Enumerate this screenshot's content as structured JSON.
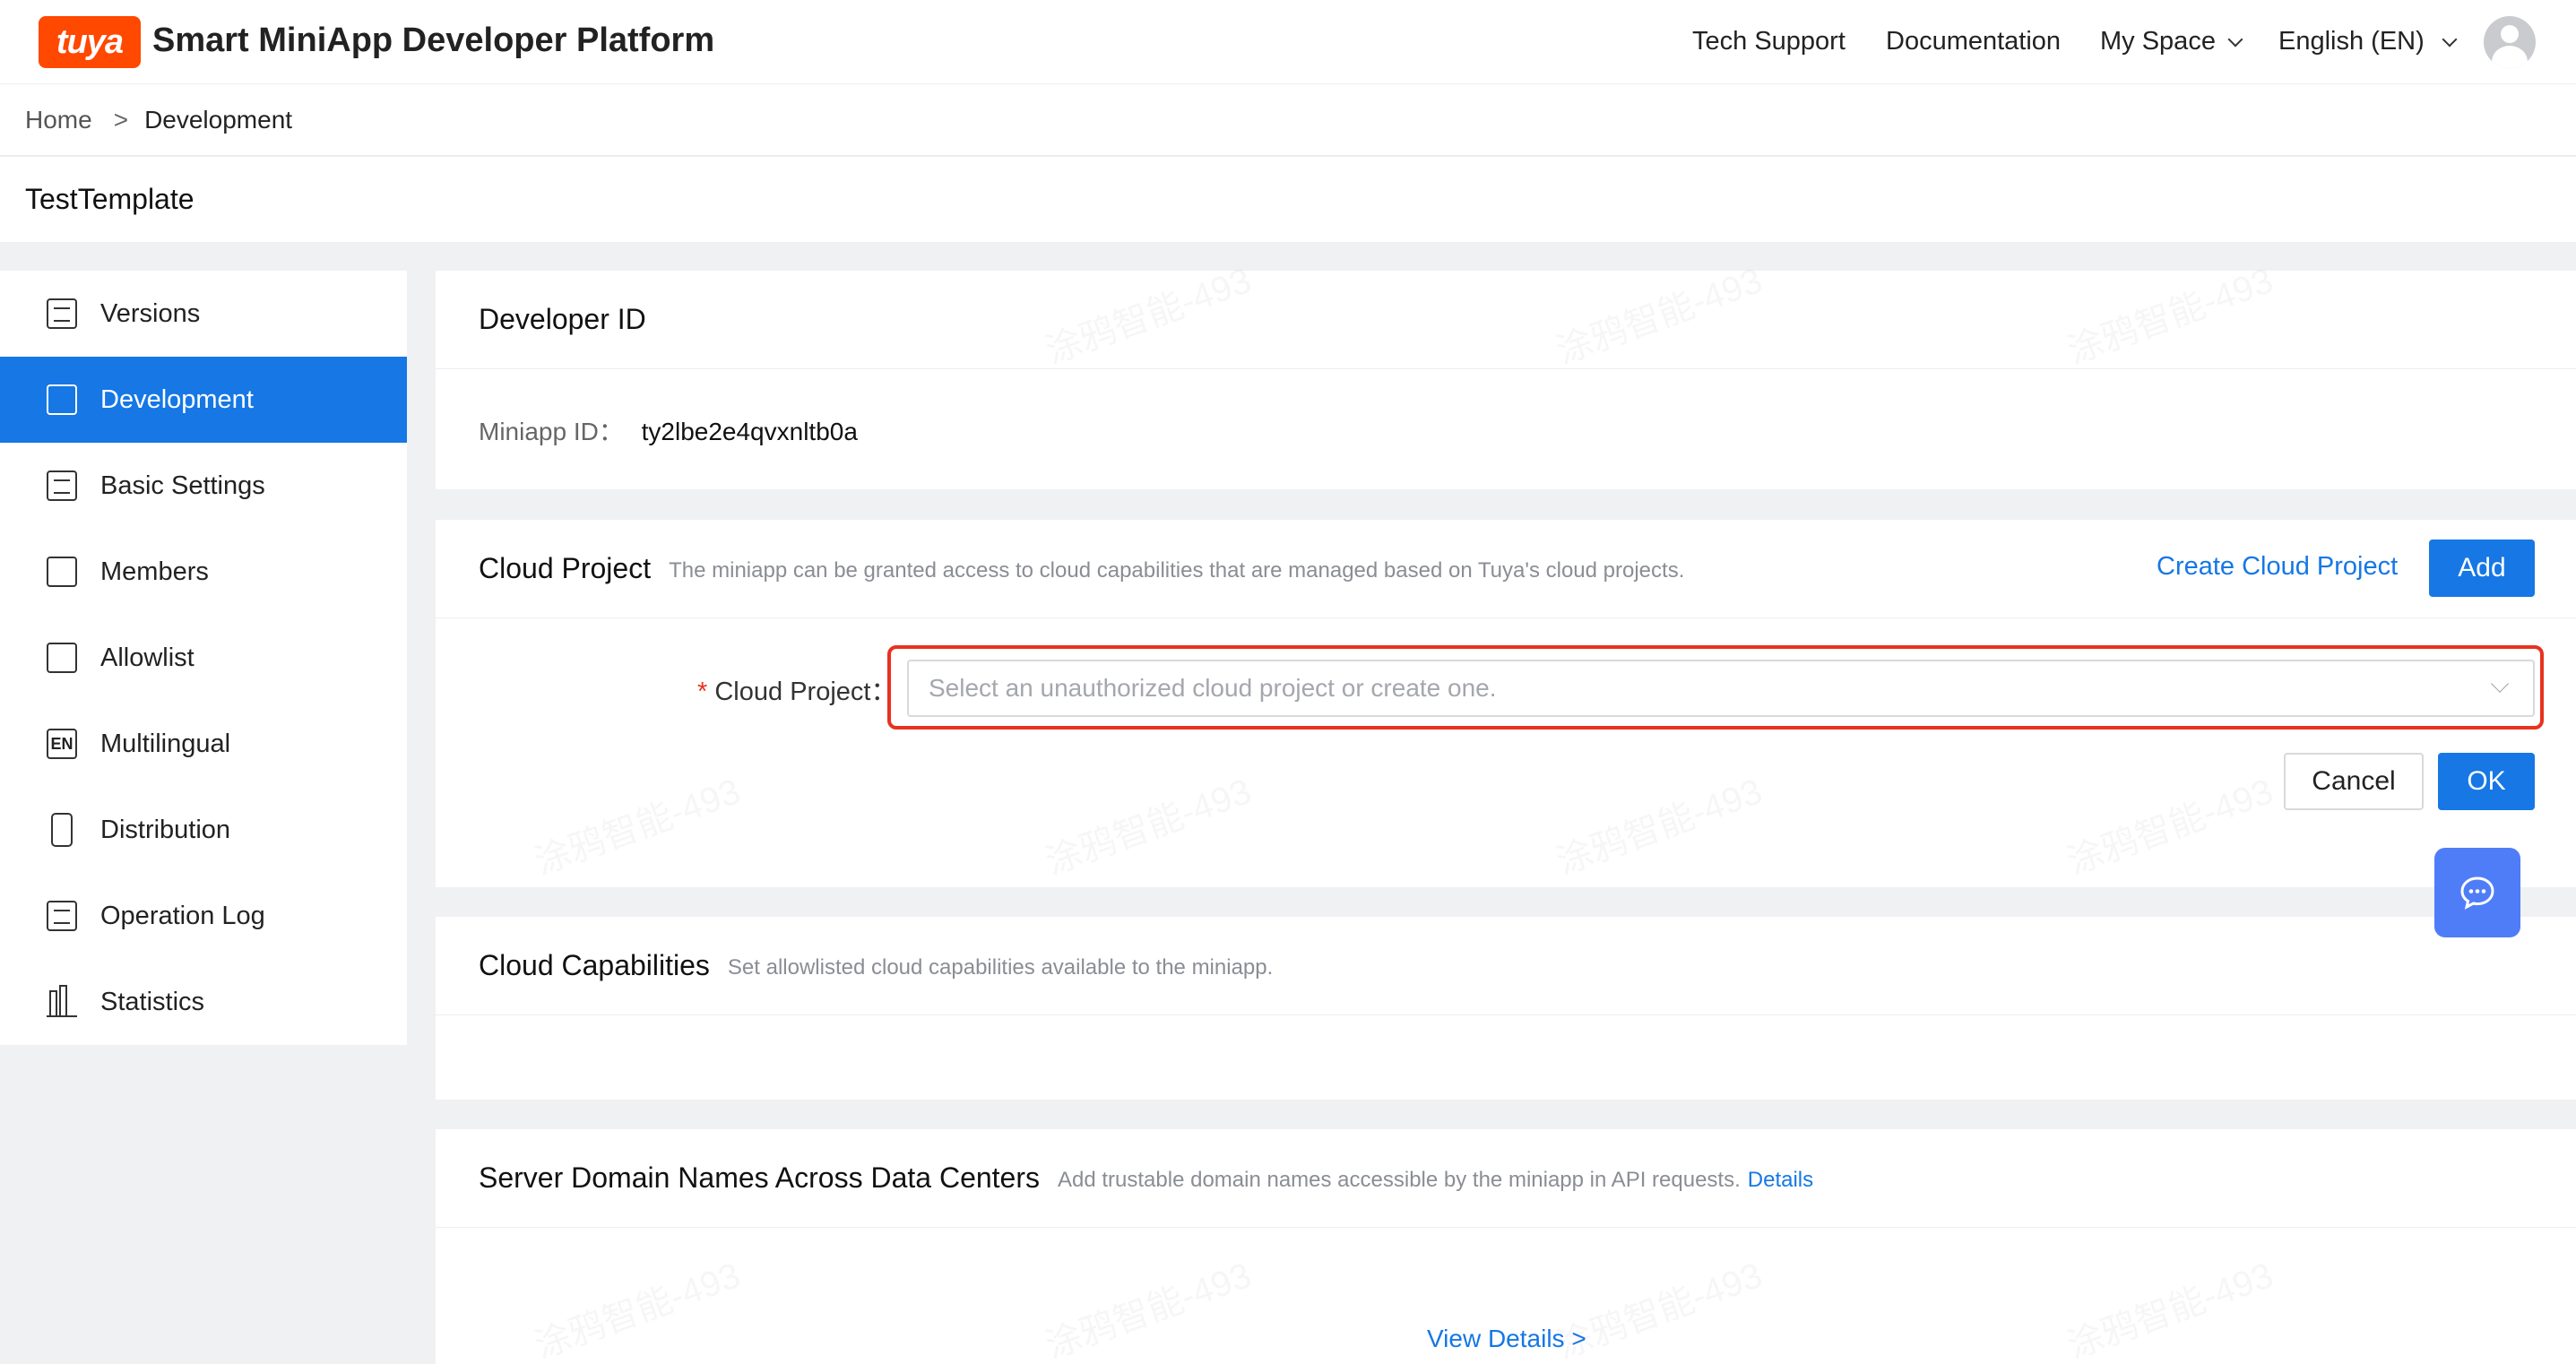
{
  "header": {
    "logo_text": "tuya",
    "app_title": "Smart MiniApp Developer Platform",
    "nav": {
      "tech_support": "Tech Support",
      "documentation": "Documentation",
      "my_space": "My Space",
      "language": "English (EN)"
    }
  },
  "breadcrumb": {
    "home": "Home",
    "separator": ">",
    "current": "Development"
  },
  "page_title": "TestTemplate",
  "sidebar": {
    "items": [
      {
        "label": "Versions",
        "icon": "versions-icon"
      },
      {
        "label": "Development",
        "icon": "development-icon",
        "active": true
      },
      {
        "label": "Basic Settings",
        "icon": "settings-doc-icon"
      },
      {
        "label": "Members",
        "icon": "members-icon"
      },
      {
        "label": "Allowlist",
        "icon": "allowlist-icon"
      },
      {
        "label": "Multilingual",
        "icon": "en-icon"
      },
      {
        "label": "Distribution",
        "icon": "phone-icon"
      },
      {
        "label": "Operation Log",
        "icon": "log-icon"
      },
      {
        "label": "Statistics",
        "icon": "bar-chart-icon"
      }
    ]
  },
  "developer_id": {
    "title": "Developer ID",
    "miniapp_id_label": "Miniapp ID：",
    "miniapp_id_value": "ty2lbe2e4qvxnltb0a"
  },
  "cloud_project": {
    "title": "Cloud Project",
    "description": "The miniapp can be granted access to cloud capabilities that are managed based on Tuya's cloud projects.",
    "create_link": "Create Cloud Project",
    "add_button": "Add",
    "required_mark": "*",
    "field_label": "Cloud Project：",
    "select_placeholder": "Select an unauthorized cloud project or create one.",
    "cancel_button": "Cancel",
    "ok_button": "OK"
  },
  "cloud_capabilities": {
    "title": "Cloud Capabilities",
    "description": "Set allowlisted cloud capabilities available to the miniapp."
  },
  "server_domains": {
    "title": "Server Domain Names Across Data Centers",
    "description": "Add trustable domain names accessible by the miniapp in API requests.",
    "details_link": "Details",
    "view_details": "View Details >"
  },
  "colors": {
    "primary": "#1677e5",
    "brand": "#ff4800",
    "highlight": "#e8321e",
    "chat": "#4f7df8"
  },
  "watermark_text": "涂鸦智能-493"
}
